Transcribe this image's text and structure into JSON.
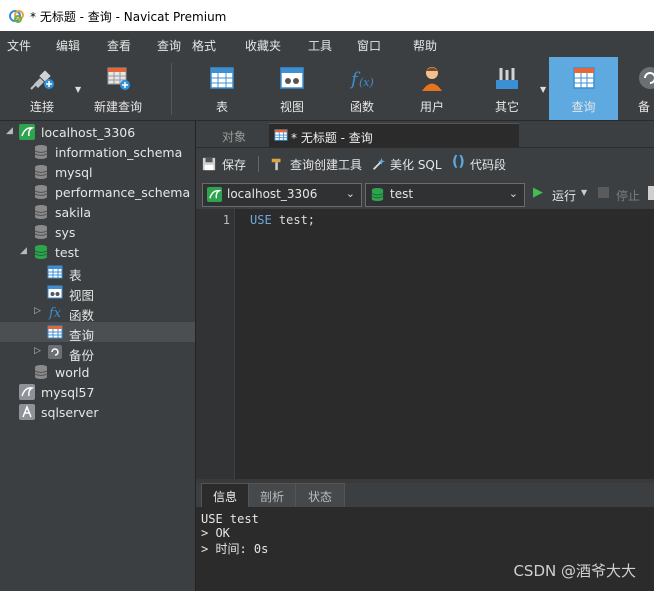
{
  "window": {
    "title": "* 无标题 - 查询 - Navicat Premium"
  },
  "menu": [
    "文件",
    "编辑",
    "查看",
    "查询",
    "格式",
    "收藏夹",
    "工具",
    "窗口",
    "帮助"
  ],
  "toolbar": {
    "connect": "连接",
    "new_query": "新建查询",
    "table": "表",
    "view": "视图",
    "function": "函数",
    "user": "用户",
    "other": "其它",
    "query": "查询",
    "backup": "备"
  },
  "tree": {
    "conn_local": "localhost_3306",
    "db_information_schema": "information_schema",
    "db_mysql": "mysql",
    "db_performance_schema": "performance_schema",
    "db_sakila": "sakila",
    "db_sys": "sys",
    "db_test": "test",
    "node_table": "表",
    "node_view": "视图",
    "node_function": "函数",
    "node_query": "查询",
    "node_backup": "备份",
    "db_world": "world",
    "conn_mysql57": "mysql57",
    "conn_sqlserver": "sqlserver"
  },
  "tabs": {
    "objects": "对象",
    "query_tab": "* 无标题 - 查询"
  },
  "query_toolbar": {
    "save": "保存",
    "builder": "查询创建工具",
    "beautify": "美化 SQL",
    "snippet": "代码段"
  },
  "selectors": {
    "connection": "localhost_3306",
    "database": "test",
    "run": "运行",
    "stop": "停止"
  },
  "editor": {
    "line_number": "1",
    "keyword": "USE",
    "rest": " test;"
  },
  "result_tabs": {
    "info": "信息",
    "profile": "剖析",
    "status": "状态"
  },
  "results": {
    "line1": "USE test",
    "line2": "> OK",
    "line3": "> 时间: 0s"
  },
  "watermark": "CSDN @酒爷大大",
  "colors": {
    "accent": "#5da9e0",
    "green": "#2ea44f",
    "dark_bg": "#2b2b2b",
    "panel_bg": "#3c3f41"
  }
}
